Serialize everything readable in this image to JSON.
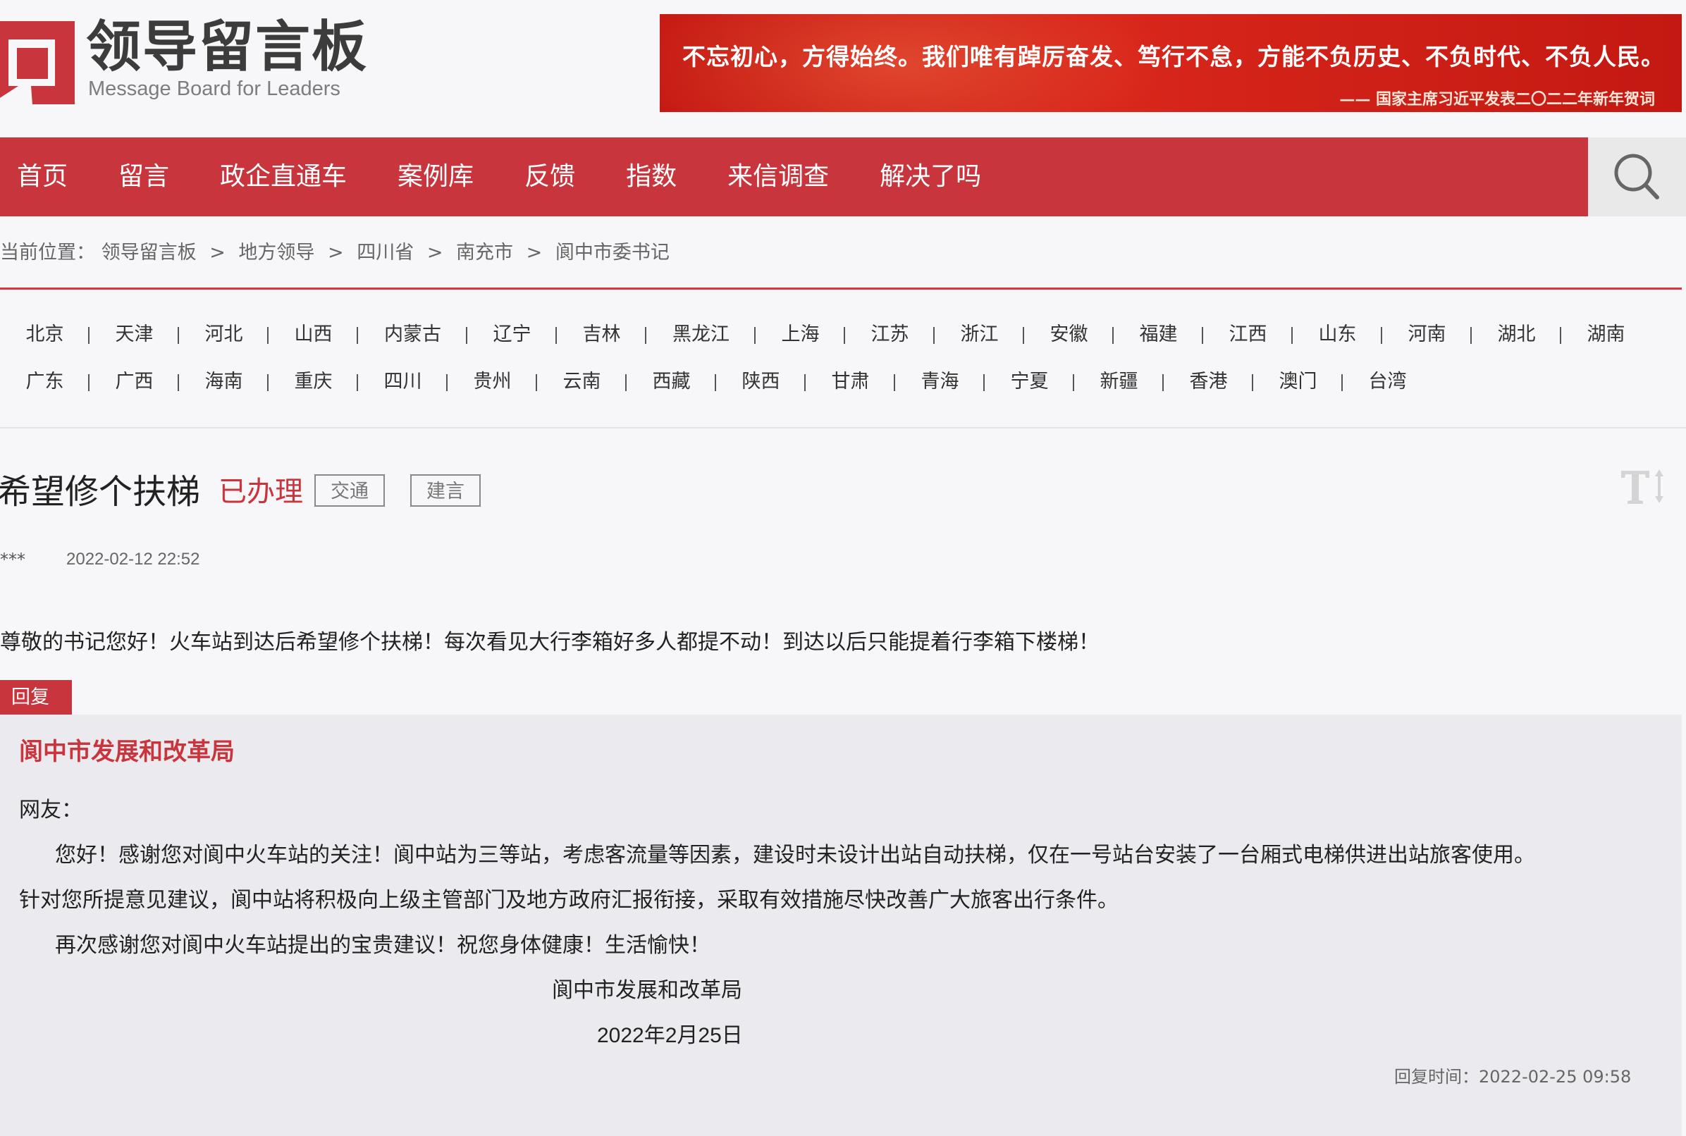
{
  "header": {
    "logo_title": "领导留言板",
    "logo_subtitle": "Message Board for Leaders",
    "banner_quote": "不忘初心，方得始终。我们唯有踔厉奋发、笃行不怠，方能不负历史、不负时代、不负人民。",
    "banner_source": "—— 国家主席习近平发表二〇二二年新年贺词"
  },
  "nav": {
    "items": [
      {
        "label": "首页"
      },
      {
        "label": "留言"
      },
      {
        "label": "政企直通车"
      },
      {
        "label": "案例库"
      },
      {
        "label": "反馈"
      },
      {
        "label": "指数"
      },
      {
        "label": "来信调查"
      },
      {
        "label": "解决了吗"
      }
    ],
    "search_icon": "search-icon"
  },
  "breadcrumb": {
    "prefix": "当前位置：",
    "items": [
      "领导留言板",
      "地方领导",
      "四川省",
      "南充市",
      "阆中市委书记"
    ],
    "separator": ">"
  },
  "regions": {
    "row1": [
      "北京",
      "天津",
      "河北",
      "山西",
      "内蒙古",
      "辽宁",
      "吉林",
      "黑龙江",
      "上海",
      "江苏",
      "浙江",
      "安徽",
      "福建",
      "江西",
      "山东",
      "河南",
      "湖北",
      "湖南"
    ],
    "row2": [
      "广东",
      "广西",
      "海南",
      "重庆",
      "四川",
      "贵州",
      "云南",
      "西藏",
      "陕西",
      "甘肃",
      "青海",
      "宁夏",
      "新疆",
      "香港",
      "澳门",
      "台湾"
    ]
  },
  "message": {
    "title": "希望修个扶梯",
    "status": "已办理",
    "tags": [
      "交通",
      "建言"
    ],
    "font_toggle_icon": "font-size-icon",
    "author": "***",
    "posted_time": "2022-02-12 22:52",
    "body": "尊敬的书记您好！火车站到达后希望修个扶梯！每次看见大行李箱好多人都提不动！到达以后只能提着行李箱下楼梯！"
  },
  "reply": {
    "tab_label": "回复",
    "replier": "阆中市发展和改革局",
    "greeting": "网友：",
    "paragraph1_line1": "您好！感谢您对阆中火车站的关注！阆中站为三等站，考虑客流量等因素，建设时未设计出站自动扶梯，仅在一号站台安装了一台厢式电梯供进出站旅客使用。",
    "paragraph1_line2": "针对您所提意见建议，阆中站将积极向上级主管部门及地方政府汇报衔接，采取有效措施尽快改善广大旅客出行条件。",
    "paragraph2": "再次感谢您对阆中火车站提出的宝贵建议！祝您身体健康！生活愉快！",
    "signature_org": "阆中市发展和改革局",
    "signature_date": "2022年2月25日",
    "reply_time": "回复时间：2022-02-25 09:58"
  },
  "colors": {
    "brand_red": "#c9353d",
    "banner_red": "#d1221a",
    "page_bg": "#f7f6f8",
    "reply_bg": "#ebebef"
  }
}
